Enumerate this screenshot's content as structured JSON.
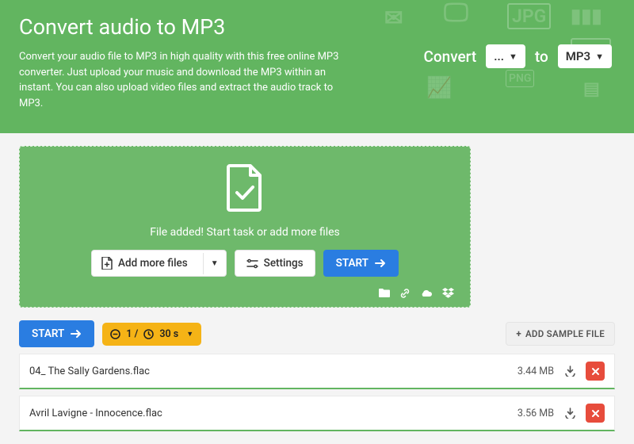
{
  "header": {
    "title": "Convert audio to MP3",
    "description": "Convert your audio file to MP3 in high quality with this free online MP3 converter. Just upload your music and download the MP3 within an instant. You can also upload video files and extract the audio track to MP3.",
    "convert_label": "Convert",
    "from_value": "...",
    "to_label": "to",
    "to_value": "MP3"
  },
  "dropzone": {
    "message": "File added! Start task or add more files",
    "add_more_label": "Add more files",
    "settings_label": "Settings",
    "start_label": "START"
  },
  "toolbar": {
    "start_label": "START",
    "limit_text": "1 / ",
    "limit_time": "30 s",
    "add_sample_label": "ADD SAMPLE FILE"
  },
  "files": [
    {
      "name": "04_ The Sally Gardens.flac",
      "size": "3.44 MB"
    },
    {
      "name": "Avril Lavigne - Innocence.flac",
      "size": "3.56 MB"
    }
  ]
}
